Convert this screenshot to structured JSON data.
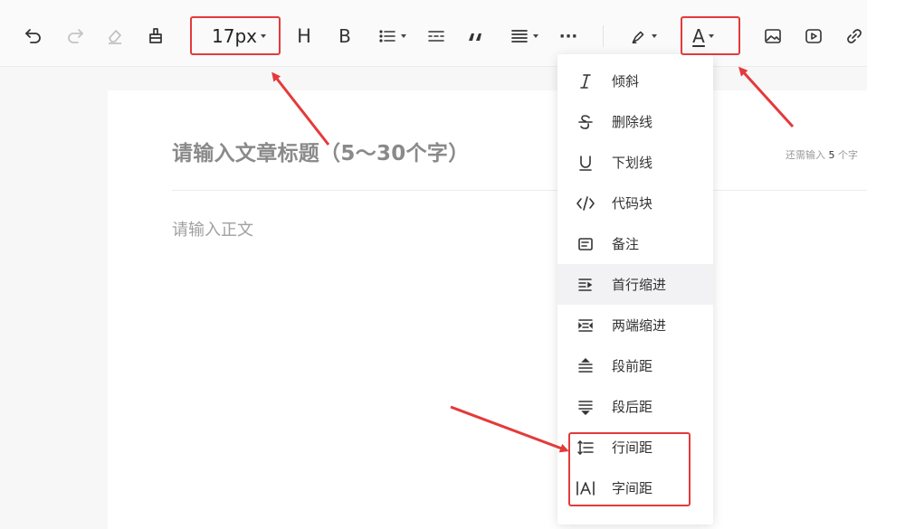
{
  "toolbar": {
    "font_size_value": "17px",
    "heading_label": "H",
    "bold_label": "B",
    "text_color_label": "A",
    "more_label": "···"
  },
  "editor": {
    "title_placeholder": "请输入文章标题（5～30个字）",
    "counter_prefix": "还需输入",
    "counter_count": "5",
    "counter_suffix": "个字",
    "body_placeholder": "请输入正文"
  },
  "dropdown": {
    "items": [
      {
        "label": "倾斜",
        "icon": "italic-icon"
      },
      {
        "label": "删除线",
        "icon": "strikethrough-icon"
      },
      {
        "label": "下划线",
        "icon": "underline-icon"
      },
      {
        "label": "代码块",
        "icon": "code-block-icon"
      },
      {
        "label": "备注",
        "icon": "note-icon"
      },
      {
        "label": "首行缩进",
        "icon": "first-line-indent-icon"
      },
      {
        "label": "两端缩进",
        "icon": "both-indent-icon"
      },
      {
        "label": "段前距",
        "icon": "space-before-icon"
      },
      {
        "label": "段后距",
        "icon": "space-after-icon"
      },
      {
        "label": "行间距",
        "icon": "line-spacing-icon"
      },
      {
        "label": "字间距",
        "icon": "letter-spacing-icon"
      }
    ],
    "active_item": "首行缩进"
  },
  "annotations": {
    "highlight_color": "#e43a3a"
  }
}
